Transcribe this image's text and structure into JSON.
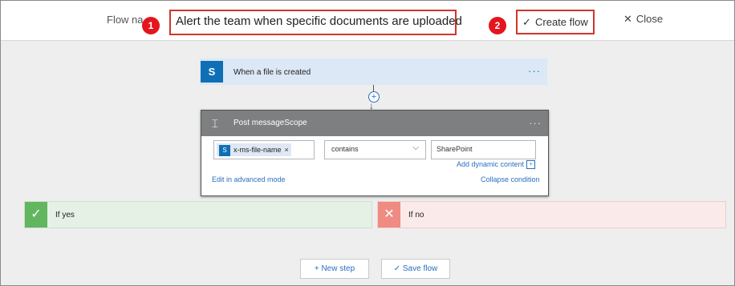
{
  "header": {
    "flow_name_label": "Flow na",
    "flow_name_value": "Alert the team when specific documents are uploaded",
    "create_flow_label": "Create flow",
    "create_flow_check": "✓",
    "close_label": "Close",
    "close_icon": "✕",
    "badge_1": "1",
    "badge_2": "2"
  },
  "trigger": {
    "title": "When a file is created",
    "icon_glyph": "S",
    "menu": "···"
  },
  "connector": {
    "plus": "+",
    "arrow": "↓"
  },
  "condition": {
    "title": "Post messageScope",
    "menu": "···",
    "token_label": "x-ms-file-name",
    "token_remove": "×",
    "token_icon_glyph": "S",
    "operator": "contains",
    "operator_chevron": "⌵",
    "value": "SharePoint",
    "add_dynamic_content": "Add dynamic content",
    "edit_advanced": "Edit in advanced mode",
    "collapse_condition": "Collapse condition"
  },
  "branches": {
    "yes_label": "If yes",
    "yes_icon": "✓",
    "no_label": "If no",
    "no_icon": "✕"
  },
  "footer": {
    "new_step": "+ New step",
    "save_flow": "✓  Save flow"
  },
  "colors": {
    "annotation_red": "#d0352f",
    "sharepoint_blue": "#0f6fb6",
    "link_blue": "#2b6fc0",
    "yes_green": "#62b65f",
    "no_red": "#ef8b82",
    "condition_header": "#7d7f81"
  }
}
